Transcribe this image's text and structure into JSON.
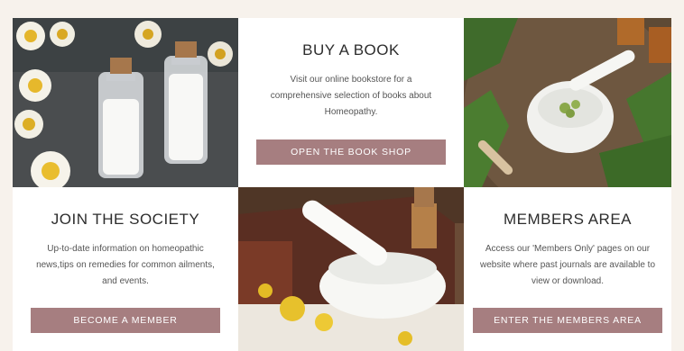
{
  "cards": {
    "buy_book": {
      "title": "BUY A BOOK",
      "description": "Visit our online bookstore for a comprehensive selection of books about Homeopathy.",
      "button": "OPEN THE BOOK SHOP"
    },
    "join_society": {
      "title": "JOIN THE SOCIETY",
      "description": "Up-to-date information on homeopathic news,tips on remedies for common ailments, and events.",
      "button": "BECOME A MEMBER"
    },
    "members_area": {
      "title": "MEMBERS AREA",
      "description": "Access our 'Members Only' pages on our website where past journals are available to view or download.",
      "button": "ENTER THE MEMBERS AREA"
    }
  },
  "colors": {
    "button": "#a67e80",
    "page_background": "#f7f2ec",
    "card_background": "#ffffff"
  }
}
